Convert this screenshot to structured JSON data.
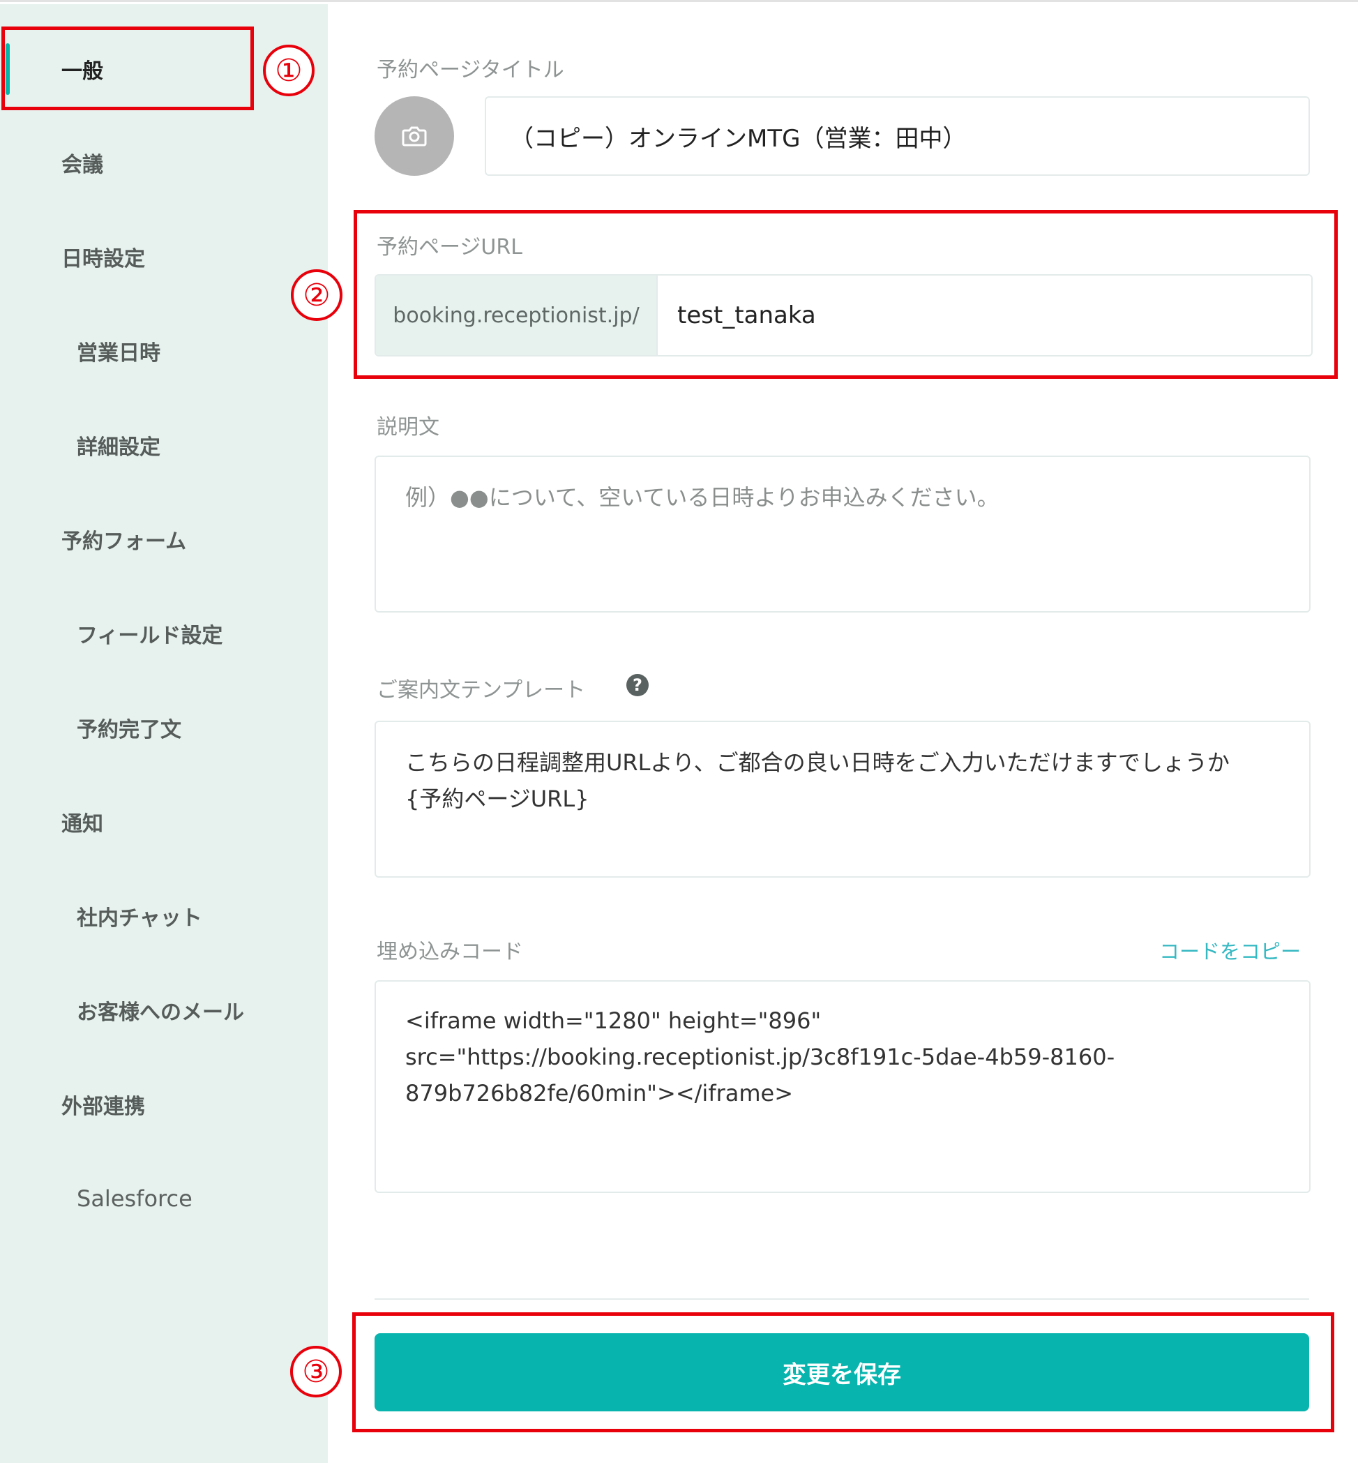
{
  "sidebar": {
    "items": [
      {
        "label": "一般"
      },
      {
        "label": "会議"
      },
      {
        "label": "日時設定"
      },
      {
        "label": "営業日時"
      },
      {
        "label": "詳細設定"
      },
      {
        "label": "予約フォーム"
      },
      {
        "label": "フィールド設定"
      },
      {
        "label": "予約完了文"
      },
      {
        "label": "通知"
      },
      {
        "label": "社内チャット"
      },
      {
        "label": "お客様へのメール"
      },
      {
        "label": "外部連携"
      },
      {
        "label": "Salesforce"
      }
    ],
    "active_color": "#07b4a8",
    "background": "#e7f2ef"
  },
  "annotations": {
    "markers": [
      "①",
      "②",
      "③"
    ],
    "color": "#e8000b"
  },
  "form": {
    "title_label": "予約ページタイトル",
    "title_value": "（コピー）オンラインMTG（営業：田中）",
    "avatar_icon": "camera-icon",
    "url_label": "予約ページURL",
    "url_prefix": "booking.receptionist.jp/",
    "url_value": "test_tanaka",
    "description_label": "説明文",
    "description_placeholder": "例）●●について、空いている日時よりお申込みください。",
    "template_label": "ご案内文テンプレート",
    "template_help_icon": "question-circle-icon",
    "template_line1": "こちらの日程調整用URLより、ご都合の良い日時をご入力いただけますでしょうか",
    "template_line2": "{予約ページURL}",
    "embed_label": "埋め込みコード",
    "copy_code_label": "コードをコピー",
    "embed_line1": "<iframe width=\"1280\" height=\"896\"",
    "embed_line2": "src=\"https://booking.receptionist.jp/3c8f191c-5dae-4b59-8160-",
    "embed_line3": "879b726b82fe/60min\"></iframe>",
    "save_label": "変更を保存",
    "save_color": "#07b4ae"
  }
}
